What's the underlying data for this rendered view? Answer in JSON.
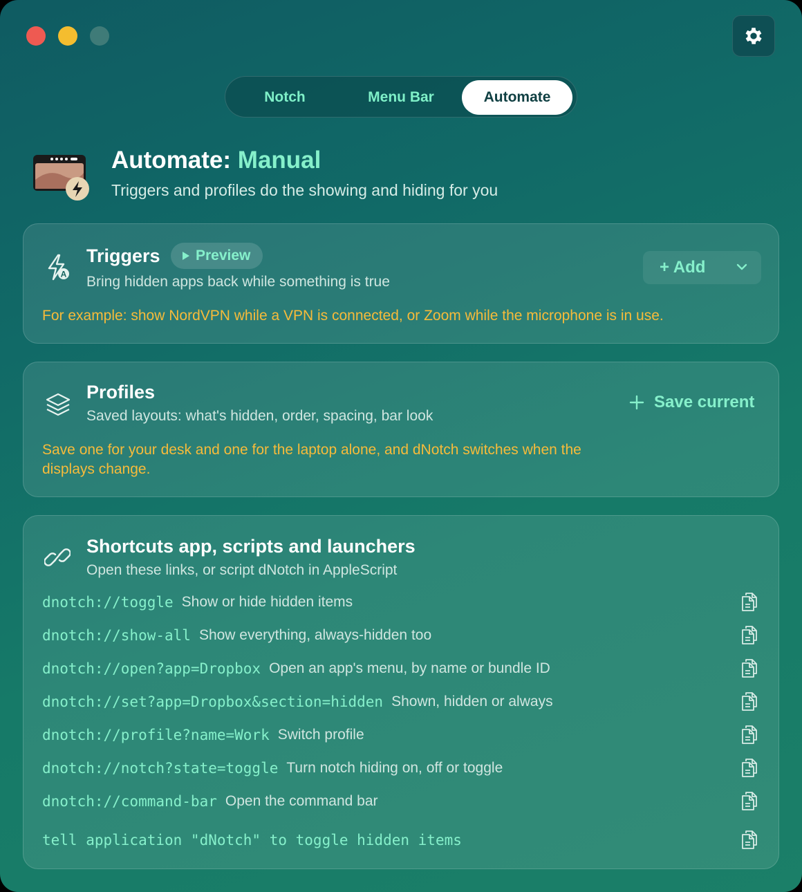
{
  "window": {
    "buttons": [
      "close",
      "minimize",
      "zoom"
    ],
    "settings_icon": "gear-icon"
  },
  "tabs": [
    {
      "label": "Notch",
      "selected": false
    },
    {
      "label": "Menu Bar",
      "selected": false
    },
    {
      "label": "Automate",
      "selected": true
    }
  ],
  "header": {
    "title_prefix": "Automate:",
    "title_mode": "Manual",
    "subtitle": "Triggers and profiles do the showing and hiding for you"
  },
  "triggers": {
    "title": "Triggers",
    "badge": "Preview",
    "subtitle": "Bring hidden apps back while something is true",
    "add_label": "Add",
    "hint": "For example: show NordVPN while a VPN is connected, or Zoom while the microphone is in use."
  },
  "profiles": {
    "title": "Profiles",
    "subtitle": "Saved layouts: what's hidden, order, spacing, bar look",
    "save_label": "Save current",
    "hint_line1": "Save one for your desk and one for the laptop alone, and dNotch switches when the",
    "hint_line2": "displays change."
  },
  "shortcuts": {
    "title": "Shortcuts app, scripts and launchers",
    "subtitle": "Open these links, or script dNotch in AppleScript",
    "links": [
      {
        "code": "dnotch://toggle",
        "desc": "Show or hide hidden items"
      },
      {
        "code": "dnotch://show-all",
        "desc": "Show everything, always-hidden too"
      },
      {
        "code": "dnotch://open?app=Dropbox",
        "desc": "Open an app's menu, by name or bundle ID"
      },
      {
        "code": "dnotch://set?app=Dropbox&section=hidden",
        "desc": "Shown, hidden or always"
      },
      {
        "code": "dnotch://profile?name=Work",
        "desc": "Switch profile"
      },
      {
        "code": "dnotch://notch?state=toggle",
        "desc": "Turn notch hiding on, off or toggle"
      },
      {
        "code": "dnotch://command-bar",
        "desc": "Open the command bar"
      }
    ],
    "applescript": "tell application \"dNotch\" to toggle hidden items"
  },
  "colors": {
    "accent": "#86f0cb",
    "hint": "#f7bb3a",
    "background": "#167a68"
  }
}
